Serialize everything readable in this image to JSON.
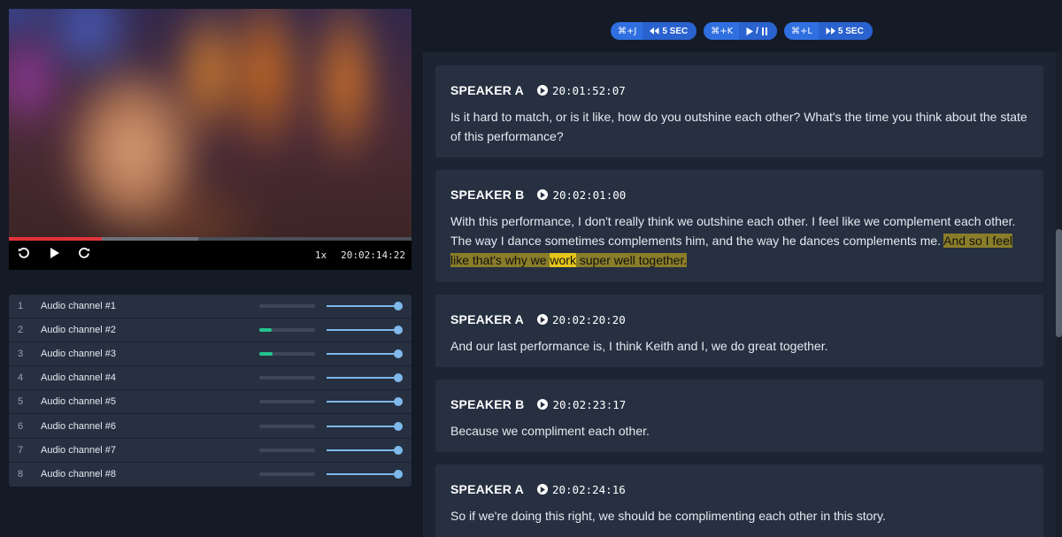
{
  "player": {
    "speed": "1x",
    "timecode": "20:02:14:22",
    "progress_percent": 23,
    "buffer_percent": 47,
    "icons": [
      "replay-icon",
      "play-icon",
      "forward-icon"
    ]
  },
  "channels": [
    {
      "num": "1",
      "name": "Audio channel #1",
      "level": 0,
      "volume": 100
    },
    {
      "num": "2",
      "name": "Audio channel #2",
      "level": 22,
      "volume": 100
    },
    {
      "num": "3",
      "name": "Audio channel #3",
      "level": 24,
      "volume": 100
    },
    {
      "num": "4",
      "name": "Audio channel #4",
      "level": 0,
      "volume": 100
    },
    {
      "num": "5",
      "name": "Audio channel #5",
      "level": 0,
      "volume": 100
    },
    {
      "num": "6",
      "name": "Audio channel #6",
      "level": 0,
      "volume": 100
    },
    {
      "num": "7",
      "name": "Audio channel #7",
      "level": 0,
      "volume": 100
    },
    {
      "num": "8",
      "name": "Audio channel #8",
      "level": 0,
      "volume": 100
    }
  ],
  "shortcuts": [
    {
      "keys": "⌘+J",
      "action": "5 SEC",
      "icon": "rewind-icon"
    },
    {
      "keys": "⌘+K",
      "action": "/",
      "icon": "play-pause-icon"
    },
    {
      "keys": "⌘+L",
      "action": "5 SEC",
      "icon": "fast-forward-icon"
    }
  ],
  "segments": [
    {
      "speaker": "SPEAKER A",
      "time": "20:01:52:07",
      "parts": [
        {
          "t": "Is it hard to match, or is it like, how do you outshine each other? What's the time you think about the state of this performance?",
          "h": ""
        }
      ]
    },
    {
      "speaker": "SPEAKER B",
      "time": "20:02:01:00",
      "parts": [
        {
          "t": "With this performance, I don't really think we outshine each other. I feel like we complement each other. The way I dance sometimes complements him, and the way he dances complements me. ",
          "h": ""
        },
        {
          "t": "And so I feel like that's why we ",
          "h": "hl"
        },
        {
          "t": "work",
          "h": "hl-strong"
        },
        {
          "t": " super well together.",
          "h": "hl"
        }
      ]
    },
    {
      "speaker": "SPEAKER A",
      "time": "20:02:20:20",
      "parts": [
        {
          "t": "And our last performance is, I think Keith and I, we do great together.",
          "h": ""
        }
      ]
    },
    {
      "speaker": "SPEAKER B",
      "time": "20:02:23:17",
      "parts": [
        {
          "t": "Because we compliment each other.",
          "h": ""
        }
      ]
    },
    {
      "speaker": "SPEAKER A",
      "time": "20:02:24:16",
      "parts": [
        {
          "t": "So if we're doing this right, we should be complimenting each other in this story.",
          "h": ""
        }
      ]
    }
  ],
  "colors": {
    "accent": "#2f6fe0",
    "meter": "#23c48d",
    "slider": "#7fb8ea",
    "highlight": "#8a7d2a",
    "highlight_active": "#e6c61a",
    "progress": "#e2343b"
  }
}
